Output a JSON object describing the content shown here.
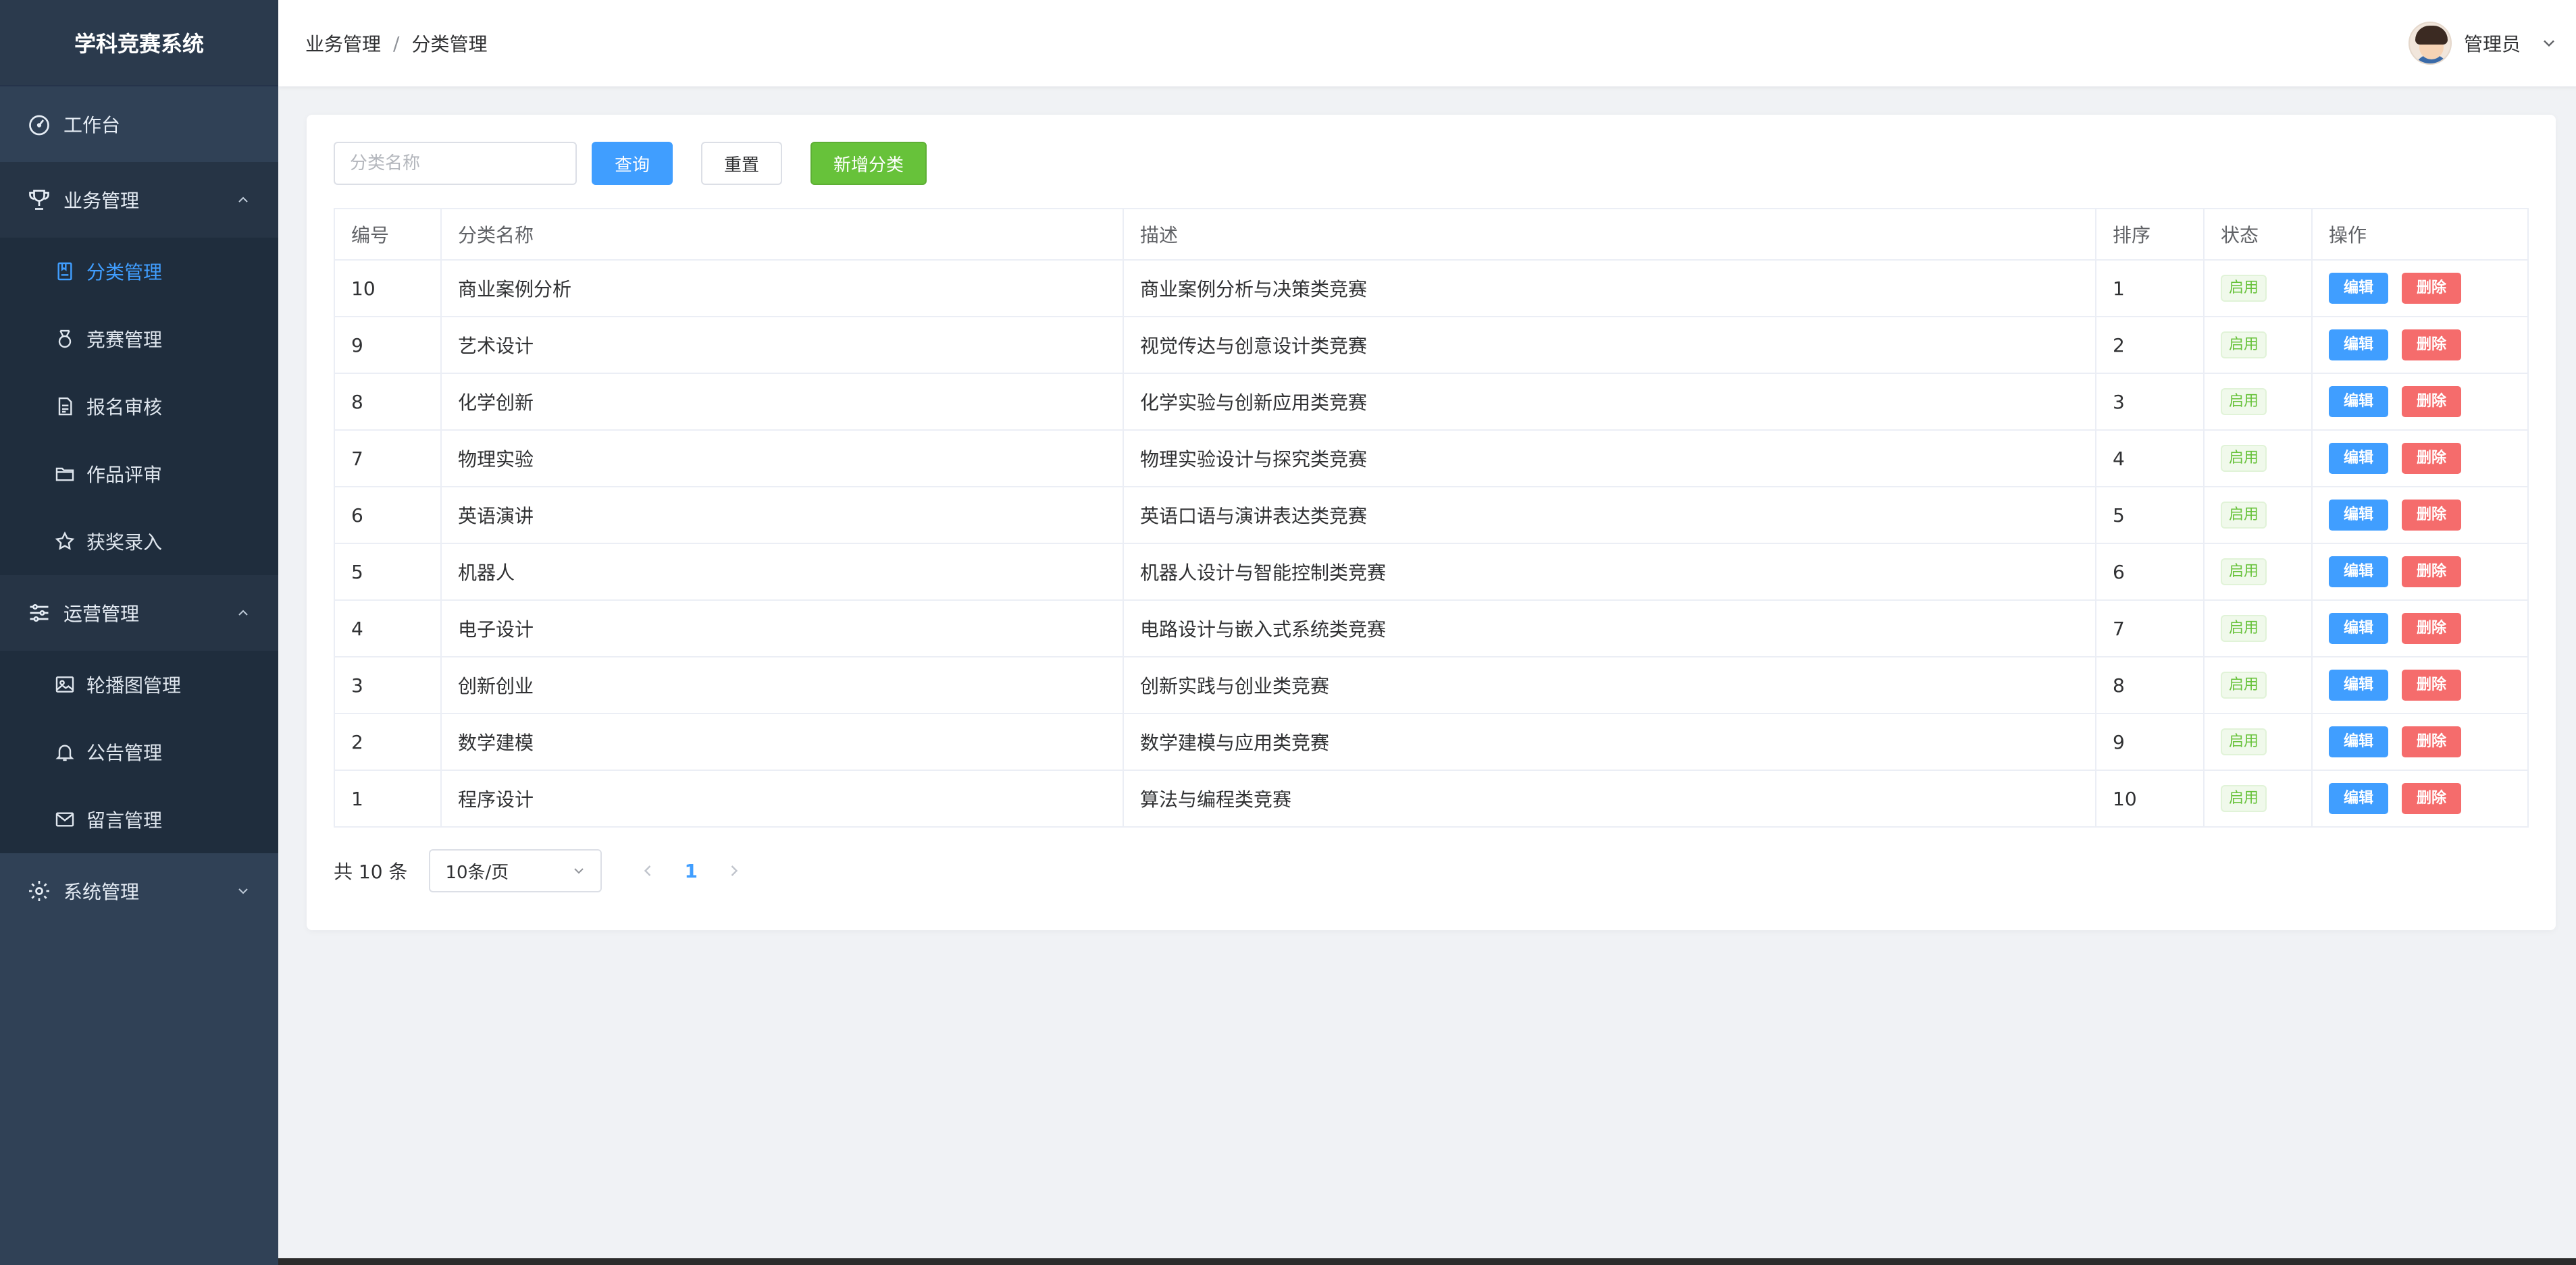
{
  "sidebar": {
    "brand": "学科竞赛系统",
    "workbench": "工作台",
    "groups": [
      {
        "label": "业务管理",
        "items": [
          {
            "label": "分类管理",
            "icon": "bookmark-icon",
            "active": true
          },
          {
            "label": "竞赛管理",
            "icon": "medal-icon"
          },
          {
            "label": "报名审核",
            "icon": "document-icon"
          },
          {
            "label": "作品评审",
            "icon": "folder-icon"
          },
          {
            "label": "获奖录入",
            "icon": "star-icon"
          }
        ]
      },
      {
        "label": "运营管理",
        "items": [
          {
            "label": "轮播图管理",
            "icon": "picture-icon"
          },
          {
            "label": "公告管理",
            "icon": "bell-icon"
          },
          {
            "label": "留言管理",
            "icon": "message-icon"
          }
        ]
      }
    ],
    "system": "系统管理"
  },
  "header": {
    "breadcrumb": [
      "业务管理",
      "分类管理"
    ],
    "breadcrumb_sep": "/",
    "user": "管理员"
  },
  "toolbar": {
    "search_placeholder": "分类名称",
    "query": "查询",
    "reset": "重置",
    "add": "新增分类"
  },
  "table": {
    "columns": [
      "编号",
      "分类名称",
      "描述",
      "排序",
      "状态",
      "操作"
    ],
    "rows": [
      {
        "id": "10",
        "name": "商业案例分析",
        "desc": "商业案例分析与决策类竞赛",
        "sort": "1",
        "status": "启用"
      },
      {
        "id": "9",
        "name": "艺术设计",
        "desc": "视觉传达与创意设计类竞赛",
        "sort": "2",
        "status": "启用"
      },
      {
        "id": "8",
        "name": "化学创新",
        "desc": "化学实验与创新应用类竞赛",
        "sort": "3",
        "status": "启用"
      },
      {
        "id": "7",
        "name": "物理实验",
        "desc": "物理实验设计与探究类竞赛",
        "sort": "4",
        "status": "启用"
      },
      {
        "id": "6",
        "name": "英语演讲",
        "desc": "英语口语与演讲表达类竞赛",
        "sort": "5",
        "status": "启用"
      },
      {
        "id": "5",
        "name": "机器人",
        "desc": "机器人设计与智能控制类竞赛",
        "sort": "6",
        "status": "启用"
      },
      {
        "id": "4",
        "name": "电子设计",
        "desc": "电路设计与嵌入式系统类竞赛",
        "sort": "7",
        "status": "启用"
      },
      {
        "id": "3",
        "name": "创新创业",
        "desc": "创新实践与创业类竞赛",
        "sort": "8",
        "status": "启用"
      },
      {
        "id": "2",
        "name": "数学建模",
        "desc": "数学建模与应用类竞赛",
        "sort": "9",
        "status": "启用"
      },
      {
        "id": "1",
        "name": "程序设计",
        "desc": "算法与编程类竞赛",
        "sort": "10",
        "status": "启用"
      }
    ],
    "edit_label": "编辑",
    "delete_label": "删除"
  },
  "pagination": {
    "total": "共 10 条",
    "page_size": "10条/页",
    "current": "1"
  },
  "colors": {
    "sidebar_bg": "#304156",
    "primary": "#409eff",
    "success": "#67c23a",
    "danger": "#f56c6c"
  }
}
